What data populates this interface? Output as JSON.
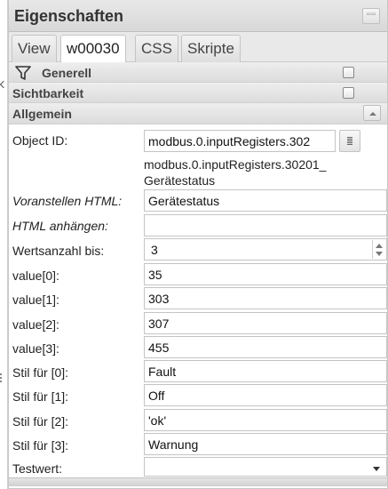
{
  "panel": {
    "title": "Eigenschaften",
    "menu_icon": "dots-icon"
  },
  "tabs": [
    {
      "label": "View",
      "active": false
    },
    {
      "label": "w00030",
      "active": true
    },
    {
      "label": "CSS",
      "active": false
    },
    {
      "label": "Skripte",
      "active": false
    }
  ],
  "sections": {
    "generell": {
      "label": "Generell",
      "icon": "filter-icon"
    },
    "sichtbarkeit": {
      "label": "Sichtbarkeit"
    },
    "allgemein": {
      "label": "Allgemein"
    }
  },
  "fields": {
    "object_id": {
      "label": "Object ID:",
      "value": "modbus.0.inputRegisters.302",
      "caption_line1": "modbus.0.inputRegisters.30201_",
      "caption_line2": "Gerätestatus"
    },
    "prepend_html": {
      "label": "Voranstellen HTML:",
      "value": "Gerätestatus"
    },
    "append_html": {
      "label": "HTML anhängen:",
      "value": ""
    },
    "value_count": {
      "label": "Wertsanzahl bis:",
      "value": "3"
    },
    "value0": {
      "label": "value[0]:",
      "value": "35"
    },
    "value1": {
      "label": "value[1]:",
      "value": "303"
    },
    "value2": {
      "label": "value[2]:",
      "value": "307"
    },
    "value3": {
      "label": "value[3]:",
      "value": "455"
    },
    "style0": {
      "label": "Stil für [0]:",
      "value": "Fault"
    },
    "style1": {
      "label": "Stil für [1]:",
      "value": "Off"
    },
    "style2": {
      "label": "Stil für [2]:",
      "value": "'ok'"
    },
    "style3": {
      "label": "Stil für [3]:",
      "value": "Warnung"
    },
    "test_value": {
      "label": "Testwert:",
      "value": ""
    }
  }
}
